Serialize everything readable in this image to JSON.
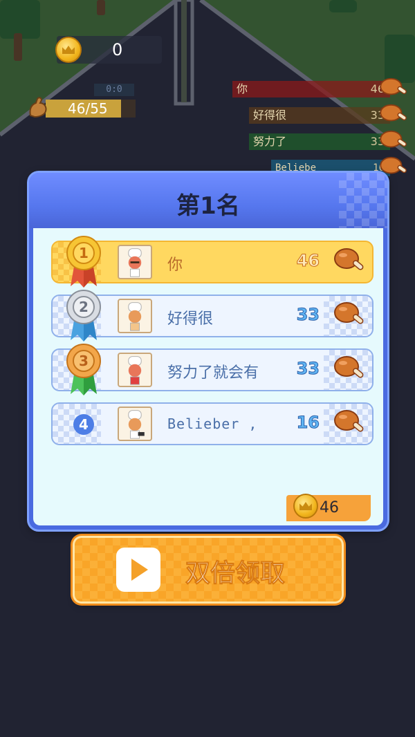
{
  "hud": {
    "coins": "0",
    "timer": "0:0",
    "hp_value": "46/",
    "hp_max": "55",
    "hp_fraction": 0.836,
    "mini_leaderboard": [
      {
        "name": "你",
        "score": "46",
        "color": "#8b1a1a"
      },
      {
        "name": "好得很",
        "score": "33",
        "color": "#5a3b1c"
      },
      {
        "name": "努力了",
        "score": "33",
        "color": "#1f5a2a"
      },
      {
        "name": "Beliebe",
        "score": "16",
        "color": "#1a5a7a"
      }
    ]
  },
  "panel": {
    "title": "第1名",
    "rows": [
      {
        "rank": "1",
        "name": "你",
        "score": "46",
        "medal": "gold",
        "highlight": true
      },
      {
        "rank": "2",
        "name": "好得很",
        "score": "33",
        "medal": "silver",
        "highlight": false
      },
      {
        "rank": "3",
        "name": "努力了就会有",
        "score": "33",
        "medal": "bronze",
        "highlight": false
      },
      {
        "rank": "4",
        "name": "Belieber ,",
        "score": "16",
        "medal": "none",
        "highlight": false
      }
    ],
    "reward": "46"
  },
  "double_button": {
    "label": "双倍领取"
  },
  "icons": {
    "coin": "coin-icon",
    "drumstick": "drumstick-icon",
    "play": "play-icon",
    "arm": "flexed-arm-icon",
    "medal": "medal-icon",
    "chef_avatar": "chef-avatar"
  },
  "colors": {
    "panel_header": "#5677ee",
    "panel_body": "#e6fafd",
    "first_row": "#ffd860",
    "button": "#f9a528"
  }
}
